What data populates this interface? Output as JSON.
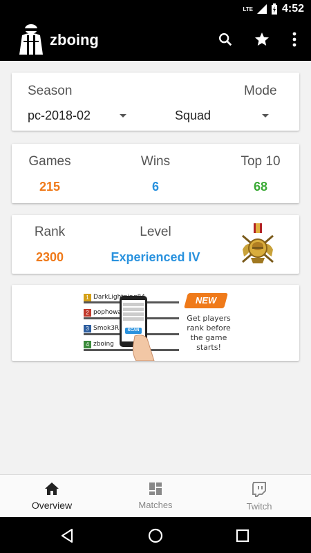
{
  "status": {
    "network": "LTE",
    "time": "4:52"
  },
  "app": {
    "title": "zboing"
  },
  "filters": {
    "season_label": "Season",
    "mode_label": "Mode",
    "season_value": "pc-2018-02",
    "mode_value": "Squad"
  },
  "stats": {
    "games_label": "Games",
    "games_value": "215",
    "wins_label": "Wins",
    "wins_value": "6",
    "top10_label": "Top 10",
    "top10_value": "68"
  },
  "rank": {
    "rank_label": "Rank",
    "rank_value": "2300",
    "level_label": "Level",
    "level_value": "Experienced IV"
  },
  "ad": {
    "players": [
      {
        "num": "1",
        "name": "DarkLightning84",
        "color": "#d4a017"
      },
      {
        "num": "2",
        "name": "pophowa",
        "color": "#c0392b"
      },
      {
        "num": "3",
        "name": "Smok3R",
        "color": "#2c5d9e"
      },
      {
        "num": "4",
        "name": "zboing",
        "color": "#3a8a3a"
      }
    ],
    "badge": "NEW",
    "text": "Get players rank before the game starts!",
    "scan_label": "SCAN"
  },
  "nav": {
    "overview": "Overview",
    "matches": "Matches",
    "twitch": "Twitch"
  },
  "colors": {
    "orange": "#ef7a1a",
    "blue": "#2a92de",
    "green": "#3aaa35"
  }
}
